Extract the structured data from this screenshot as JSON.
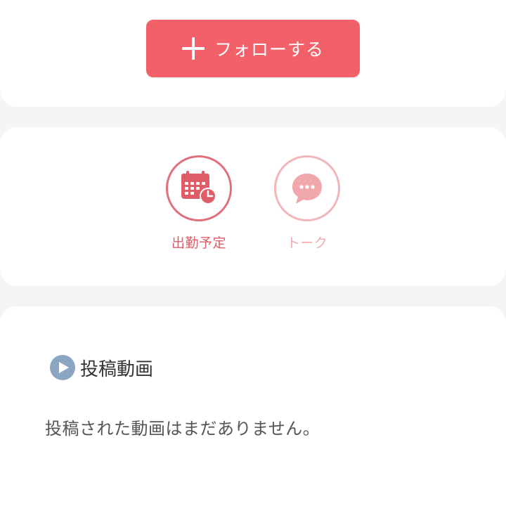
{
  "top": {
    "cut_text": "...",
    "follow_button_label": "フォローする"
  },
  "actions": [
    {
      "label": "出勤予定",
      "icon": "calendar-clock-icon",
      "color": "#de5d68"
    },
    {
      "label": "トーク",
      "icon": "chat-bubble-icon",
      "color": "#f1a8ad"
    }
  ],
  "videos": {
    "title": "投稿動画",
    "empty_message": "投稿された動画はまだありません。",
    "icon": "play-circle-icon"
  },
  "colors": {
    "accent": "#f2606a",
    "schedule": "#de5d68",
    "talk": "#f1a8ad",
    "play_icon": "#8aa6c3",
    "background": "#f4f5f6"
  }
}
